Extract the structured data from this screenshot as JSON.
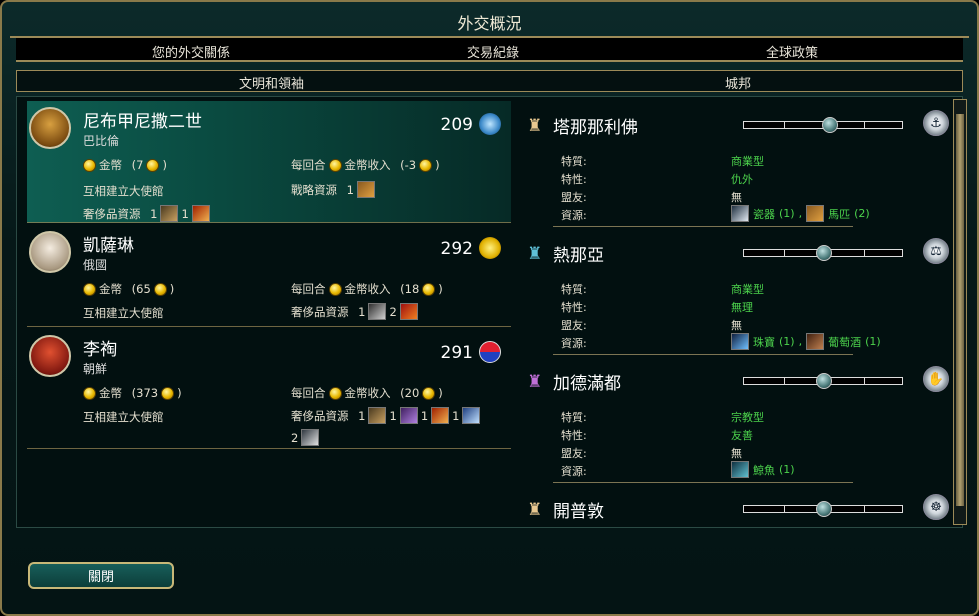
{
  "title": "外交概況",
  "tabs": [
    "您的外交關係",
    "交易紀錄",
    "全球政策"
  ],
  "section_headers": {
    "left": "文明和領袖",
    "right": "城邦"
  },
  "civs": [
    {
      "leader": "尼布甲尼撒二世",
      "civ": "巴比倫",
      "score": "209",
      "gold_label": "金幣",
      "gold": "(7",
      "gold_close": ")",
      "gpt_prefix": "每回合",
      "gpt_label": "金幣收入",
      "gpt": "(-3",
      "gpt_close": ")",
      "embassy": "互相建立大使館",
      "strategic_label": "戰略資源",
      "strategic_count": "1",
      "luxury_label": "奢侈品資源",
      "luxury": [
        "1",
        "1"
      ]
    },
    {
      "leader": "凱薩琳",
      "civ": "俄國",
      "score": "292",
      "gold_label": "金幣",
      "gold": "(65",
      "gold_close": ")",
      "gpt_prefix": "每回合",
      "gpt_label": "金幣收入",
      "gpt": "(18",
      "gpt_close": ")",
      "embassy": "互相建立大使館",
      "luxury_label": "奢侈品資源",
      "luxury": [
        "1",
        "2"
      ]
    },
    {
      "leader": "李祹",
      "civ": "朝鮮",
      "score": "291",
      "gold_label": "金幣",
      "gold": "(373",
      "gold_close": ")",
      "gpt_prefix": "每回合",
      "gpt_label": "金幣收入",
      "gpt": "(20",
      "gpt_close": ")",
      "embassy": "互相建立大使館",
      "luxury_label": "奢侈品資源",
      "luxury": [
        "1",
        "1",
        "1",
        "1",
        "2"
      ]
    }
  ],
  "city_states": [
    {
      "name": "塔那那利佛",
      "color": "#e8c890",
      "type_icon": "maritime-icon",
      "influence": 0.55,
      "k_type": "特質:",
      "type": "商業型",
      "k_trait": "特性:",
      "trait": "仇外",
      "k_ally": "盟友:",
      "ally": "無",
      "k_res": "資源:",
      "resources": [
        {
          "name": "瓷器",
          "count": "(1)",
          "sep": ","
        },
        {
          "name": "馬匹",
          "count": "(2)"
        }
      ]
    },
    {
      "name": "熱那亞",
      "color": "#5fc0d8",
      "type_icon": "mercantile-icon",
      "influence": 0.5,
      "k_type": "特質:",
      "type": "商業型",
      "k_trait": "特性:",
      "trait": "無理",
      "k_ally": "盟友:",
      "ally": "無",
      "k_res": "資源:",
      "resources": [
        {
          "name": "珠寶",
          "count": "(1)",
          "sep": ","
        },
        {
          "name": "葡萄酒",
          "count": "(1)"
        }
      ]
    },
    {
      "name": "加德滿都",
      "color": "#c070d8",
      "type_icon": "religious-icon",
      "influence": 0.5,
      "k_type": "特質:",
      "type": "宗教型",
      "k_trait": "特性:",
      "trait": "友善",
      "k_ally": "盟友:",
      "ally": "無",
      "k_res": "資源:",
      "resources": [
        {
          "name": "鯨魚",
          "count": "(1)"
        }
      ]
    },
    {
      "name": "開普敦",
      "color": "#e8c890",
      "type_icon": "maritime-icon",
      "influence": 0.5
    }
  ],
  "close_label": "關閉"
}
